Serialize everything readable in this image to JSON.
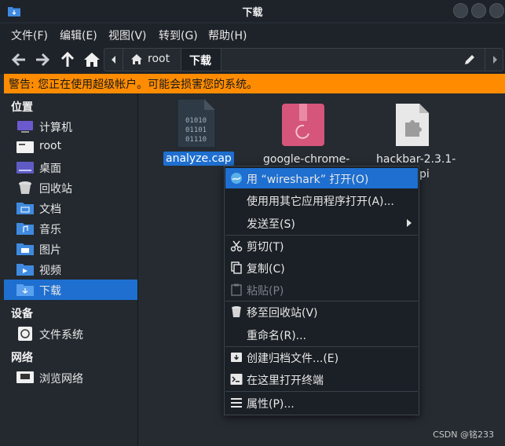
{
  "window": {
    "title": "下载"
  },
  "menubar": {
    "items": [
      "文件(F)",
      "编辑(E)",
      "视图(V)",
      "转到(G)",
      "帮助(H)"
    ]
  },
  "pathbar": {
    "crumbs": [
      "root",
      "下载"
    ]
  },
  "warning": {
    "text": "警告: 您正在使用超级帐户。可能会损害您的系统。"
  },
  "sidebar": {
    "places_header": "位置",
    "places": [
      "计算机",
      "root",
      "桌面",
      "回收站",
      "文档",
      "音乐",
      "图片",
      "视频",
      "下载"
    ],
    "devices_header": "设备",
    "devices": [
      "文件系统"
    ],
    "network_header": "网络",
    "network": [
      "浏览网络"
    ]
  },
  "files": [
    {
      "name": "analyze.cap",
      "icon": "binary-file-icon",
      "selected": true
    },
    {
      "name": "google-chrome-",
      "icon": "debian-package-icon"
    },
    {
      "name": "hackbar-2.3.1-",
      "name_line2": "pi",
      "icon": "plugin-file-icon"
    }
  ],
  "context_menu": {
    "items": [
      "用 “wireshark” 打开(O)",
      "使用用其它应用程序打开(A)...",
      "发送至(S)",
      "剪切(T)",
      "复制(C)",
      "粘贴(P)",
      "移至回收站(V)",
      "重命名(R)...",
      "创建归档文件...(E)",
      "在这里打开终端",
      "属性(P)..."
    ]
  },
  "watermark": "CSDN @铭233",
  "colors": {
    "accent": "#1e6fd0",
    "warning": "#ff8c00",
    "background": "#242b33"
  }
}
